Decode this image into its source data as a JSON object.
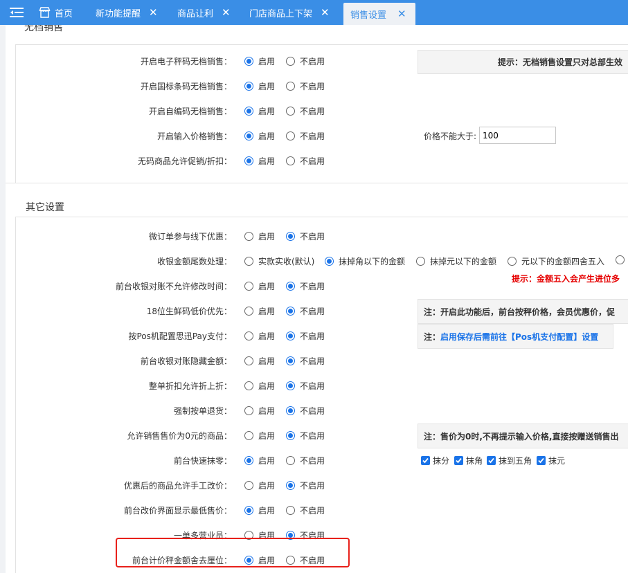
{
  "tabs": [
    {
      "label": "首页",
      "closable": false,
      "active": false
    },
    {
      "label": "新功能提醒",
      "closable": true,
      "active": false
    },
    {
      "label": "商品让利",
      "closable": true,
      "active": false
    },
    {
      "label": "门店商品上下架",
      "closable": true,
      "active": false
    },
    {
      "label": "销售设置",
      "closable": true,
      "active": true
    }
  ],
  "tab_close_glyph": "✕",
  "colors": {
    "tab_bar": "#3a8ee6",
    "radio_selected": "#1a73e8",
    "warning_text": "#e60000",
    "highlight_box": "#e8211b"
  },
  "icons": [
    "menu-toggle-icon",
    "home-icon",
    "close-icon",
    "checkbox-checked-icon"
  ],
  "section_unregistered": {
    "title": "无档销售",
    "rows": [
      {
        "label": "开启电子秤码无档销售：",
        "options": [
          "启用",
          "不启用"
        ],
        "selected": 0
      },
      {
        "label": "开启国标条码无档销售：",
        "options": [
          "启用",
          "不启用"
        ],
        "selected": 0
      },
      {
        "label": "开启自编码无档销售：",
        "options": [
          "启用",
          "不启用"
        ],
        "selected": 0
      },
      {
        "label": "开启输入价格销售：",
        "options": [
          "启用",
          "不启用"
        ],
        "selected": 0
      },
      {
        "label": "无码商品允许促销/折扣：",
        "options": [
          "启用",
          "不启用"
        ],
        "selected": 0
      }
    ],
    "tip": "提示：无档销售设置只对总部生效",
    "price_limit_label": "价格不能大于:",
    "price_limit_value": "100"
  },
  "section_other": {
    "title": "其它设置",
    "rows": [
      {
        "label": "微订单参与线下优惠：",
        "options": [
          "启用",
          "不启用"
        ],
        "selected": 1
      },
      {
        "label": "收银金额尾数处理：",
        "options": [
          "实款实收(默认)",
          "抹掉角以下的金额",
          "抹掉元以下的金额",
          "元以下的金额四舍五入",
          ""
        ],
        "selected": 1
      },
      {
        "label": "前台收银对账不允许修改时间：",
        "options": [
          "启用",
          "不启用"
        ],
        "selected": 1
      },
      {
        "label": "18位生鲜码低价优先：",
        "options": [
          "启用",
          "不启用"
        ],
        "selected": 1
      },
      {
        "label": "按Pos机配置思迅Pay支付：",
        "options": [
          "启用",
          "不启用"
        ],
        "selected": 1
      },
      {
        "label": "前台收银对账隐藏金额：",
        "options": [
          "启用",
          "不启用"
        ],
        "selected": 1
      },
      {
        "label": "整单折扣允许折上折：",
        "options": [
          "启用",
          "不启用"
        ],
        "selected": 1
      },
      {
        "label": "强制按单退货：",
        "options": [
          "启用",
          "不启用"
        ],
        "selected": 1
      },
      {
        "label": "允许销售售价为0元的商品：",
        "options": [
          "启用",
          "不启用"
        ],
        "selected": 1
      },
      {
        "label": "前台快速抹零：",
        "options": [
          "启用",
          "不启用"
        ],
        "selected": 0
      },
      {
        "label": "优惠后的商品允许手工改价：",
        "options": [
          "启用",
          "不启用"
        ],
        "selected": 1
      },
      {
        "label": "前台改价界面显示最低售价：",
        "options": [
          "启用",
          "不启用"
        ],
        "selected": 0
      },
      {
        "label": "一单多营业员：",
        "options": [
          "启用",
          "不启用"
        ],
        "selected": 1
      },
      {
        "label": "前台计价秤金额舍去厘位：",
        "options": [
          "启用",
          "不启用"
        ],
        "selected": 0
      }
    ],
    "rounding_warning": "提示：金额五入会产生进位多",
    "note_fresh_code": "注：开启此功能后，前台按秤价格，会员优惠价，促",
    "note_pos_pay_prefix": "注：",
    "note_pos_pay_text": "启用保存后需前往【Pos机支付配置】设置",
    "note_zero_price": "注：售价为0时,不再提示输入价格,直接按赠送销售出",
    "quick_round_checks": [
      {
        "label": "抹分",
        "checked": true
      },
      {
        "label": "抹角",
        "checked": true
      },
      {
        "label": "抹到五角",
        "checked": true
      },
      {
        "label": "抹元",
        "checked": true
      }
    ]
  }
}
